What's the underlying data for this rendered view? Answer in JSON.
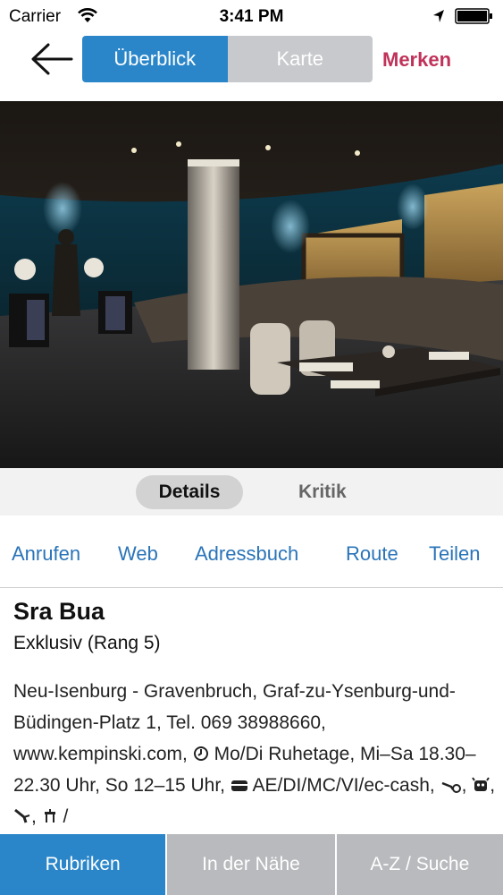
{
  "status": {
    "carrier": "Carrier",
    "time": "3:41 PM"
  },
  "nav": {
    "segments": [
      "Überblick",
      "Karte"
    ],
    "active_segment": "Überblick",
    "bookmark": "Merken"
  },
  "photo": {
    "subject": "restaurant-interior"
  },
  "subtabs": [
    "Details",
    "Kritik"
  ],
  "actions": [
    "Anrufen",
    "Web",
    "Adressbuch",
    "Route",
    "Teilen"
  ],
  "restaurant": {
    "name": "Sra Bua",
    "category": "Exklusiv (Rang 5)",
    "address": "Neu-Isenburg - Gravenbruch, Graf-zu-Ysenburg-und-Büdingen-Platz 1, Tel. 069 38988660, www.kempinski.com,",
    "hours": "Mo/Di Ruhetage, Mi–Sa 18.30–22.30 Uhr, So 12–15 Uhr,",
    "payment": "AE/DI/MC/VI/ec-cash,",
    "trailing": "/"
  },
  "tabbar": [
    "Rubriken",
    "In der Nähe",
    "A-Z / Suche"
  ],
  "colors": {
    "accent": "#2a86c9",
    "link": "#2a74b8",
    "bookmark": "#c0325a",
    "inactive": "#b8babd"
  }
}
